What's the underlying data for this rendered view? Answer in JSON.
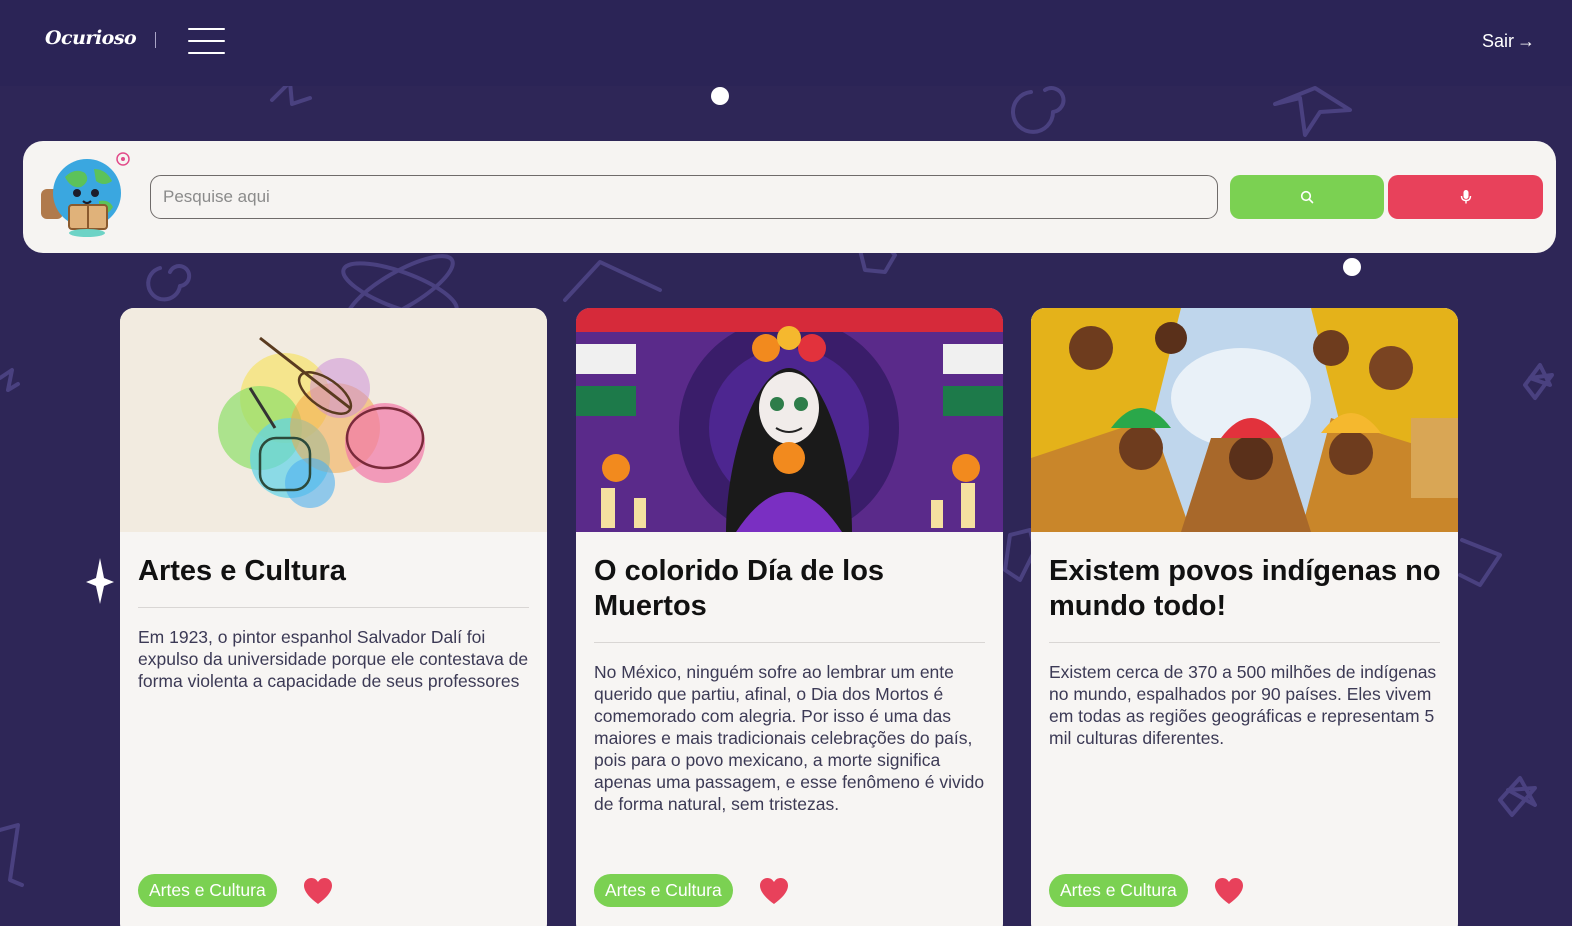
{
  "header": {
    "logo": "Ocurioso",
    "logout_label": "Sair",
    "logout_arrow": "→"
  },
  "search": {
    "placeholder": "Pesquise aqui",
    "search_button_icon": "search-icon",
    "voice_button_icon": "microphone-icon"
  },
  "colors": {
    "background": "#2e2657",
    "header": "#2b2456",
    "panel": "#f6f4f2",
    "accent_green": "#7bd152",
    "accent_red": "#e8415b"
  },
  "cards": [
    {
      "title": "Artes e Cultura",
      "text": "Em 1923, o pintor espanhol Salvador Dalí foi expulso da universidade porque ele contestava de forma violenta a capacidade de seus professores",
      "tag": "Artes e Cultura",
      "image": "watercolor-art-illustration"
    },
    {
      "title": "O colorido Día de los Muertos",
      "text": "No México, ninguém sofre ao lembrar um ente querido que partiu, afinal, o Dia dos Mortos é comemorado com alegria. Por isso é uma das maiores e mais tradicionais celebrações do país, pois para o povo mexicano, a morte significa apenas uma passagem, e esse fenômeno é vivido de forma natural, sem tristezas.",
      "tag": "Artes e Cultura",
      "image": "catrina-illustration"
    },
    {
      "title": "Existem povos indígenas no mundo todo!",
      "text": "Existem cerca de 370 a 500 milhões de indígenas no mundo, espalhados por 90 países. Eles vivem em todas as regiões geográficas e representam 5 mil culturas diferentes.",
      "tag": "Artes e Cultura",
      "image": "indigenous-people-photo"
    }
  ]
}
